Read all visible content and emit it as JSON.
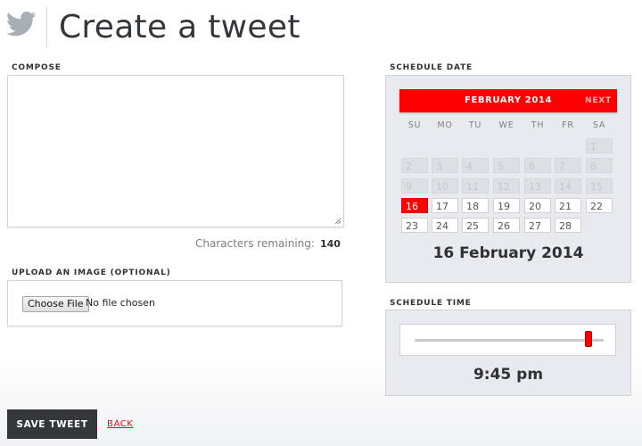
{
  "header": {
    "title": "Create a tweet",
    "logo_icon": "twitter-bird-icon"
  },
  "compose": {
    "label": "COMPOSE",
    "value": "",
    "chars_remaining_label": "Characters remaining:",
    "chars_remaining": "140"
  },
  "upload": {
    "label": "UPLOAD AN IMAGE (OPTIONAL)",
    "button_label": "Choose File",
    "file_status": "No file chosen"
  },
  "schedule_date": {
    "label": "SCHEDULE DATE",
    "month_label": "FEBRUARY 2014",
    "next_label": "NEXT",
    "weekdays": [
      "SU",
      "MO",
      "TU",
      "WE",
      "TH",
      "FR",
      "SA"
    ],
    "weeks": [
      [
        null,
        null,
        null,
        null,
        null,
        null,
        {
          "day": "1",
          "state": "disabled"
        }
      ],
      [
        {
          "day": "2",
          "state": "disabled"
        },
        {
          "day": "3",
          "state": "disabled"
        },
        {
          "day": "4",
          "state": "disabled"
        },
        {
          "day": "5",
          "state": "disabled"
        },
        {
          "day": "6",
          "state": "disabled"
        },
        {
          "day": "7",
          "state": "disabled"
        },
        {
          "day": "8",
          "state": "disabled"
        }
      ],
      [
        {
          "day": "9",
          "state": "disabled"
        },
        {
          "day": "10",
          "state": "disabled"
        },
        {
          "day": "11",
          "state": "disabled"
        },
        {
          "day": "12",
          "state": "disabled"
        },
        {
          "day": "13",
          "state": "disabled"
        },
        {
          "day": "14",
          "state": "disabled"
        },
        {
          "day": "15",
          "state": "disabled"
        }
      ],
      [
        {
          "day": "16",
          "state": "selected"
        },
        {
          "day": "17",
          "state": "enabled"
        },
        {
          "day": "18",
          "state": "enabled"
        },
        {
          "day": "19",
          "state": "enabled"
        },
        {
          "day": "20",
          "state": "enabled"
        },
        {
          "day": "21",
          "state": "enabled"
        },
        {
          "day": "22",
          "state": "enabled"
        }
      ],
      [
        {
          "day": "23",
          "state": "enabled"
        },
        {
          "day": "24",
          "state": "enabled"
        },
        {
          "day": "25",
          "state": "enabled"
        },
        {
          "day": "26",
          "state": "enabled"
        },
        {
          "day": "27",
          "state": "enabled"
        },
        {
          "day": "28",
          "state": "enabled"
        },
        null
      ]
    ],
    "selected_display": "16 February 2014"
  },
  "schedule_time": {
    "label": "SCHEDULE TIME",
    "slider_fraction": 0.92,
    "display": "9:45 pm"
  },
  "actions": {
    "save_label": "SAVE TWEET",
    "back_label": "BACK"
  },
  "colors": {
    "accent": "#ff0000",
    "dark_button": "#34383d",
    "panel_bg": "#e8eaed",
    "icon_gray": "#a8afb6"
  }
}
